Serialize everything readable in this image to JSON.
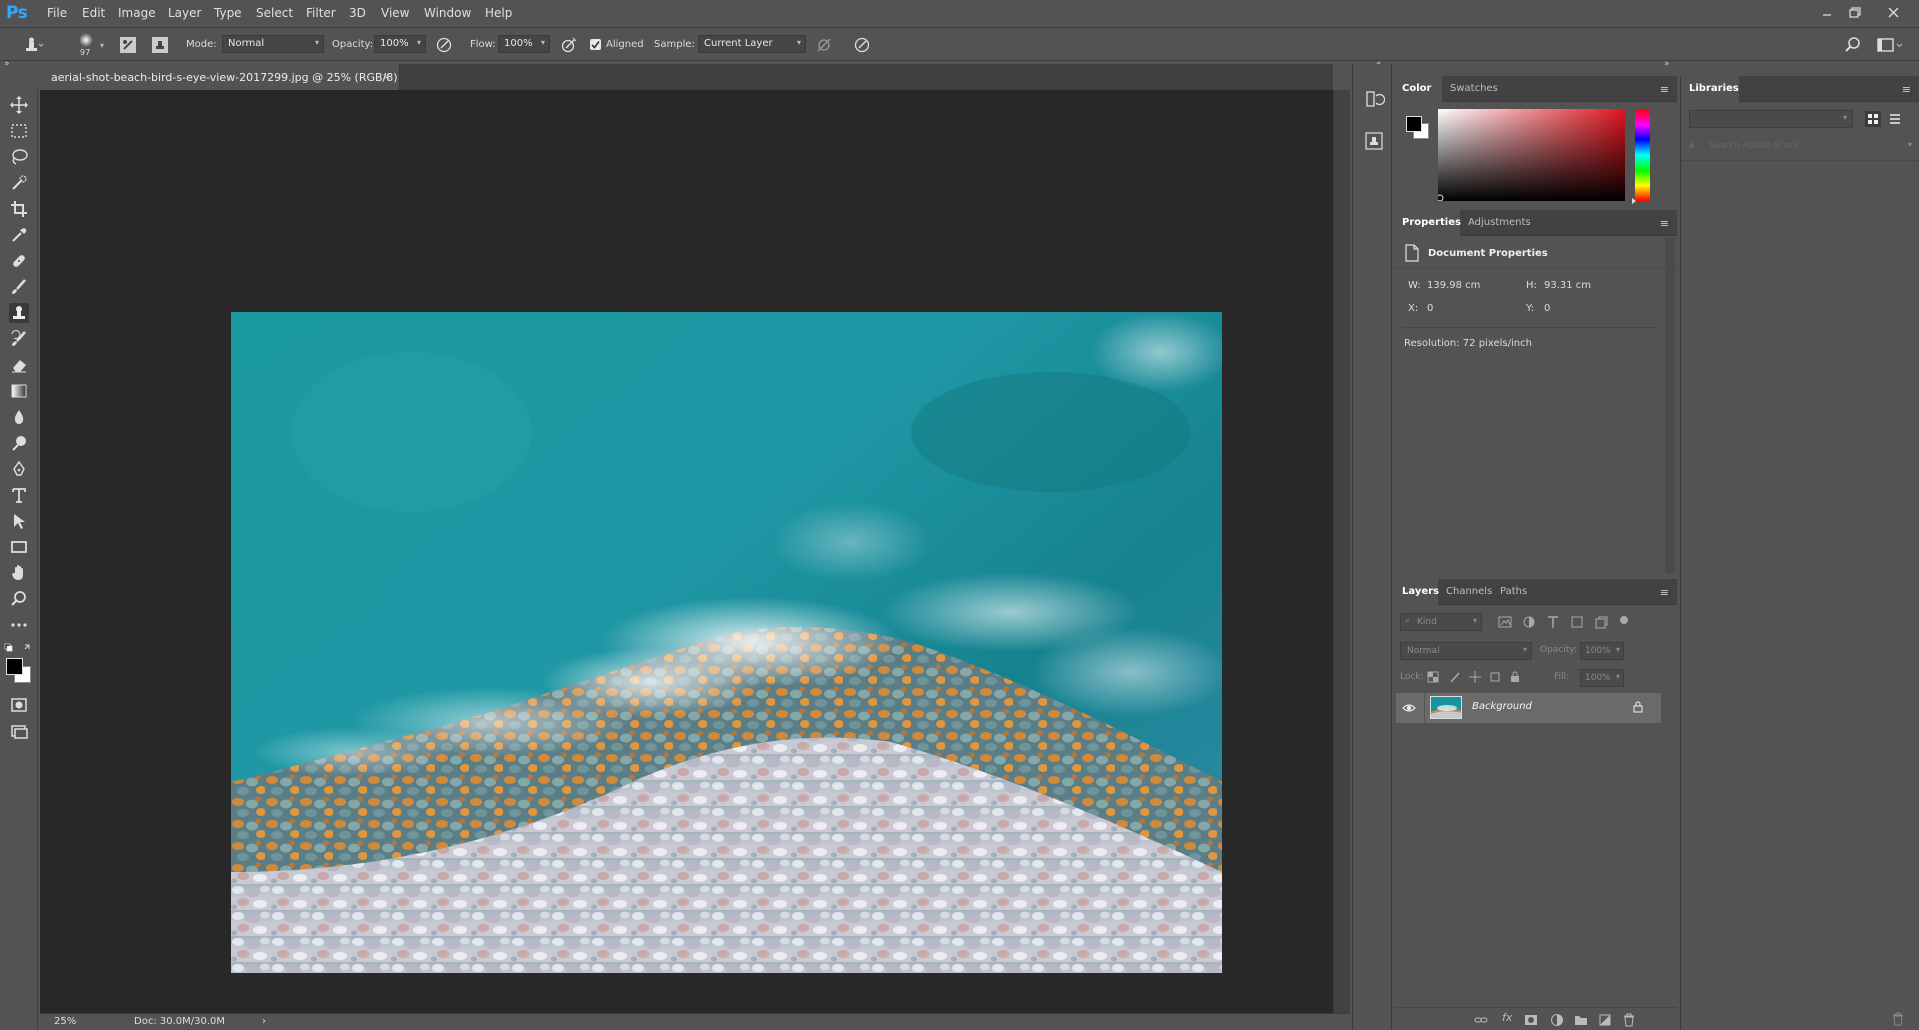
{
  "app": {
    "logo": "Ps"
  },
  "menu": [
    "File",
    "Edit",
    "Image",
    "Layer",
    "Type",
    "Select",
    "Filter",
    "3D",
    "View",
    "Window",
    "Help"
  ],
  "options": {
    "brush_size": "97",
    "mode_label": "Mode:",
    "mode_value": "Normal",
    "opacity_label": "Opacity:",
    "opacity_value": "100%",
    "flow_label": "Flow:",
    "flow_value": "100%",
    "aligned_label": "Aligned",
    "aligned_checked": true,
    "sample_label": "Sample:",
    "sample_value": "Current Layer"
  },
  "document": {
    "tab_title": "aerial-shot-beach-bird-s-eye-view-2017299.jpg @ 25% (RGB/8)",
    "close_glyph": "×",
    "zoom": "25%",
    "doc_size": "Doc: 30.0M/30.0M",
    "status_arrow": "›"
  },
  "color_panel": {
    "tabs": [
      "Color",
      "Swatches"
    ],
    "active_tab": "Color",
    "hue_color": "#e0141e"
  },
  "properties_panel": {
    "tabs": [
      "Properties",
      "Adjustments"
    ],
    "active_tab": "Properties",
    "section_title": "Document Properties",
    "w_label": "W:",
    "w_value": "139.98 cm",
    "h_label": "H:",
    "h_value": "93.31 cm",
    "x_label": "X:",
    "x_value": "0",
    "y_label": "Y:",
    "y_value": "0",
    "resolution": "Resolution: 72 pixels/inch"
  },
  "layers_panel": {
    "tabs": [
      "Layers",
      "Channels",
      "Paths"
    ],
    "active_tab": "Layers",
    "filter_placeholder": "Kind",
    "blend_mode": "Normal",
    "opacity_label": "Opacity:",
    "opacity_value": "100%",
    "lock_label": "Lock:",
    "fill_label": "Fill:",
    "fill_value": "100%",
    "layers": [
      {
        "name": "Background",
        "visible": true,
        "locked": true
      }
    ]
  },
  "libraries_panel": {
    "title": "Libraries",
    "search_placeholder": "Search Adobe Stock"
  },
  "colors": {
    "foreground": "#000000",
    "background": "#ffffff",
    "accent": "#31a8ff"
  },
  "icons": {
    "tools": [
      "move-icon",
      "marquee-icon",
      "lasso-icon",
      "quick-select-icon",
      "crop-icon",
      "eyedropper-icon",
      "healing-brush-icon",
      "brush-icon",
      "clone-stamp-icon",
      "history-brush-icon",
      "eraser-icon",
      "gradient-icon",
      "blur-icon",
      "dodge-icon",
      "pen-icon",
      "type-icon",
      "path-select-icon",
      "rectangle-icon",
      "hand-icon",
      "zoom-icon",
      "more-tools-icon"
    ]
  }
}
